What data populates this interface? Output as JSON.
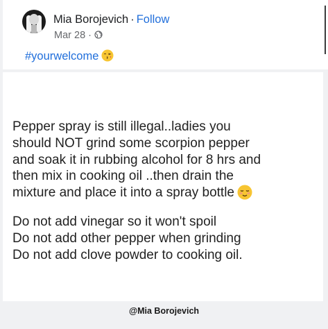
{
  "post": {
    "author": "Mia Borojevich",
    "separator": "·",
    "follow_label": "Follow",
    "date": "Mar 28",
    "meta_separator": "·",
    "audience_icon": "globe-icon",
    "hashtag": "#yourwelcome",
    "hashtag_emoji": "kissing-face-emoji"
  },
  "note": {
    "lines": [
      "Pepper spray is still illegal..ladies you",
      "should NOT  grind some scorpion pepper",
      "and soak it in rubbing alcohol for 8 hrs and",
      "then mix in cooking oil ..then drain the",
      "mixture and place it into a spray bottle"
    ],
    "line_end_emoji": "relieved-face-emoji",
    "rules": [
      "Do not add vinegar so it won't spoil",
      "Do not add other pepper when grinding",
      "Do not add clove powder to cooking oil."
    ]
  },
  "watermark": "@Mia Borojevich",
  "colors": {
    "link": "#216fdb",
    "text": "#222222",
    "muted": "#65676b",
    "background": "#f0f1f3"
  }
}
